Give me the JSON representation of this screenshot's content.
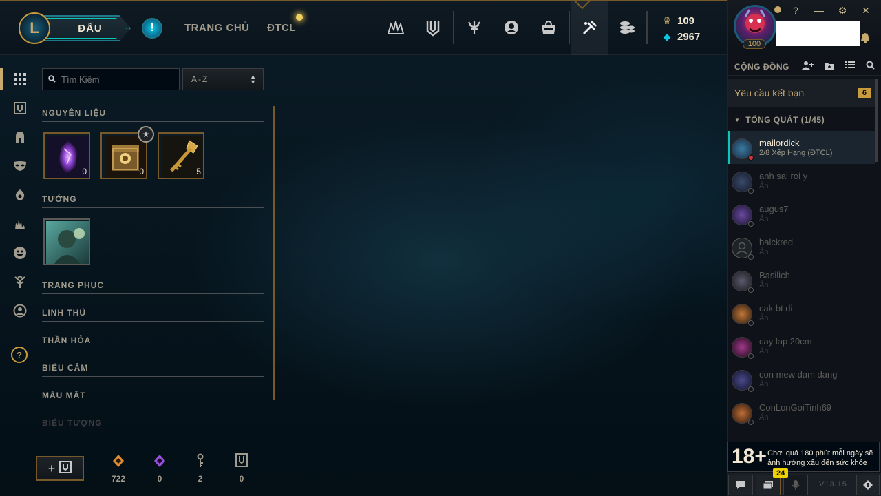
{
  "topbar": {
    "play_label": "ĐẤU",
    "alert_icon": "!",
    "nav": [
      "TRANG CHỦ",
      "ĐTCL"
    ],
    "icons": [
      "tft-icon",
      "collection-icon",
      "ranked-icon",
      "profile-icon",
      "store-icon",
      "loot-icon",
      "currency-icon"
    ],
    "currency": {
      "rp": "109",
      "be": "2967"
    }
  },
  "sidebar": {
    "items": [
      "grid-icon",
      "chest-icon",
      "champion-icon",
      "mask-icon",
      "ward-icon",
      "fire-icon",
      "emote-icon",
      "tree-icon",
      "profile-icon",
      "help-icon"
    ]
  },
  "loot": {
    "search_placeholder": "Tìm Kiếm",
    "sort_value": "A-Z",
    "sections": {
      "materials": "NGUYÊN LIỆU",
      "champions": "TƯỚNG",
      "skins": "TRANG PHỤC",
      "companions": "LINH THÚ",
      "ward_skins": "THẦN HỎA",
      "emotes": "BIỂU CẢM",
      "eternals": "MẪU MẮT",
      "icons": "BIỂU TƯỢNG"
    },
    "materials": [
      {
        "name": "mythic-essence-icon",
        "count": "0"
      },
      {
        "name": "hextech-chest-icon",
        "count": "0"
      },
      {
        "name": "hextech-key-icon",
        "count": "5"
      }
    ],
    "footer": {
      "craft_label": "+",
      "essences": [
        {
          "icon": "orange-essence-icon",
          "value": "722"
        },
        {
          "icon": "mythic-essence-icon",
          "value": "0"
        },
        {
          "icon": "key-fragment-icon",
          "value": "2"
        },
        {
          "icon": "chest-icon",
          "value": "0"
        }
      ]
    }
  },
  "social": {
    "level": "100",
    "title": "CỘNG ĐỒNG",
    "friend_requests_label": "Yêu cầu kết bạn",
    "friend_requests_count": "6",
    "group_label": "TỔNG QUÁT (1/45)",
    "friends": [
      {
        "name": "mailordick",
        "status": "2/8 Xếp Hạng (ĐTCL)",
        "online": true
      },
      {
        "name": "anh sai roi y",
        "status": "Ẩn",
        "online": false
      },
      {
        "name": "augus7",
        "status": "Ẩn",
        "online": false
      },
      {
        "name": "balckred",
        "status": "Ẩn",
        "online": false
      },
      {
        "name": "Basilich",
        "status": "Ẩn",
        "online": false
      },
      {
        "name": "cak bt di",
        "status": "Ẩn",
        "online": false
      },
      {
        "name": "cay lap 20cm",
        "status": "Ẩn",
        "online": false
      },
      {
        "name": "con mew dam dang",
        "status": "Ẩn",
        "online": false
      },
      {
        "name": "ConLonGoiTinh69",
        "status": "Ẩn",
        "online": false
      }
    ],
    "age_rating": "18+",
    "warning_text": "Chơi quá 180 phút mỗi ngày sẽ ảnh hưởng xấu đến sức khỏe",
    "message_badge": "24",
    "version": "V13.15"
  },
  "colors": {
    "gold": "#c89b3c",
    "teal": "#0ac8b9",
    "background": "#010a13"
  }
}
